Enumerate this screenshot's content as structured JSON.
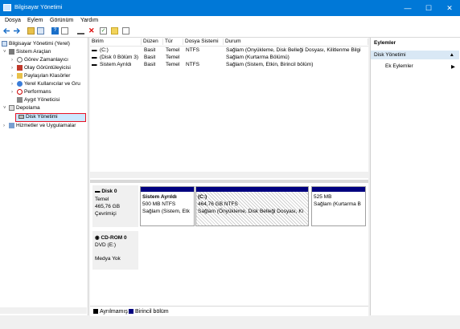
{
  "window": {
    "title": "Bilgisayar Yönetimi",
    "min": "—",
    "max": "☐",
    "close": "✕"
  },
  "menu": [
    "Dosya",
    "Eylem",
    "Görünüm",
    "Yardım"
  ],
  "toolbar_icons": [
    "back-icon",
    "forward-icon",
    "up-folder-icon",
    "console-tree-icon",
    "help-icon",
    "properties-icon",
    "connect-icon",
    "delete-icon",
    "check-icon",
    "export-icon",
    "search-icon"
  ],
  "tree": {
    "root": "Bilgisayar Yönetimi (Yerel)",
    "system_tools": "Sistem Araçları",
    "task_scheduler": "Görev Zamanlayıcı",
    "event_viewer": "Olay Görüntüleyicisi",
    "shared_folders": "Paylaşılan Klasörler",
    "local_users": "Yerel Kullanıcılar ve Gru",
    "performance": "Performans",
    "device_manager": "Aygıt Yöneticisi",
    "storage": "Depolama",
    "disk_mgmt": "Disk Yönetimi",
    "services": "Hizmetler ve Uygulamalar"
  },
  "volumes": {
    "headers": [
      "Birim",
      "Düzen",
      "Tür",
      "Dosya Sistemi",
      "Durum"
    ],
    "rows": [
      [
        "(C:)",
        "Basit",
        "Temel",
        "NTFS",
        "Sağlam (Önyükleme, Disk Belleği Dosyası, Kilitlenme Bilgi"
      ],
      [
        "(Disk 0 Bölüm 3)",
        "Basit",
        "Temel",
        "",
        "Sağlam (Kurtarma Bölümü)"
      ],
      [
        "Sistem Ayrıldı",
        "Basit",
        "Temel",
        "NTFS",
        "Sağlam (Sistem, Etkin, Birincil bölüm)"
      ]
    ]
  },
  "disk0": {
    "name": "Disk 0",
    "type": "Temel",
    "size": "465,76 GB",
    "status": "Çevrimiçi",
    "partitions": [
      {
        "name": "Sistem Ayrıldı",
        "size": "500 MB NTFS",
        "status": "Sağlam (Sistem, Etk"
      },
      {
        "name": "(C:)",
        "size": "464,76 GB NTFS",
        "status": "Sağlam (Önyükleme, Disk Belleği Dosyası, Ki"
      },
      {
        "name": "",
        "size": "525 MB",
        "status": "Sağlam (Kurtarma B"
      }
    ]
  },
  "cdrom": {
    "name": "CD-ROM 0",
    "drive": "DVD (E:)",
    "status": "Medya Yok"
  },
  "legend": {
    "unallocated": "Ayrılmamış",
    "primary": "Birincil bölüm"
  },
  "actions": {
    "header": "Eylemler",
    "section": "Disk Yönetimi",
    "more": "Ek Eylemler"
  },
  "colors": {
    "titlebar": "#0078d7",
    "partition_bar": "#00007f",
    "selection_highlight": "#e81123"
  }
}
